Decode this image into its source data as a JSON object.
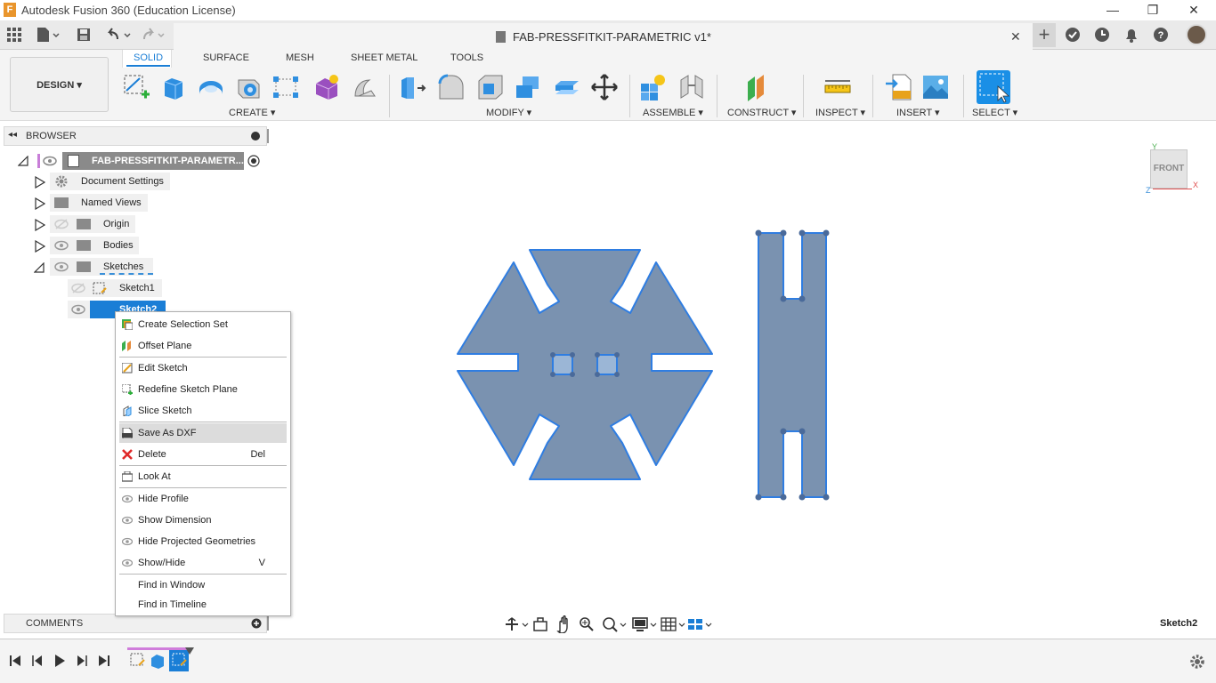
{
  "app": {
    "title": "Autodesk Fusion 360 (Education License)",
    "logo": "F",
    "minimize": "—",
    "restore": "❐",
    "close": "✕"
  },
  "document": {
    "tab_title": "FAB-PRESSFITKIT-PARAMETRIC v1*",
    "close": "✕",
    "new_tab": "+"
  },
  "workspace": {
    "mode": "DESIGN ▾",
    "tabs": [
      "SOLID",
      "SURFACE",
      "MESH",
      "SHEET METAL",
      "TOOLS"
    ],
    "active_tab": "SOLID",
    "groups": [
      "CREATE ▾",
      "MODIFY ▾",
      "ASSEMBLE ▾",
      "CONSTRUCT ▾",
      "INSPECT ▾",
      "INSERT ▾",
      "SELECT ▾"
    ]
  },
  "browser": {
    "title": "BROWSER",
    "collapse": "◂◂",
    "root": "FAB-PRESSFITKIT-PARAMETR...",
    "items": [
      {
        "label": "Document Settings",
        "icon": "gear-icon"
      },
      {
        "label": "Named Views",
        "icon": "folder-icon"
      },
      {
        "label": "Origin",
        "icon": "folder-icon"
      },
      {
        "label": "Bodies",
        "icon": "folder-icon"
      },
      {
        "label": "Sketches",
        "icon": "folder-icon"
      }
    ],
    "sketches": [
      "Sketch1",
      "Sketch2"
    ]
  },
  "context_menu": {
    "items": [
      {
        "label": "Create Selection Set",
        "shortcut": "",
        "icon": "selection-set-icon"
      },
      {
        "label": "Offset Plane",
        "shortcut": "",
        "icon": "offset-plane-icon"
      },
      {
        "label": "Edit Sketch",
        "shortcut": "",
        "icon": "edit-sketch-icon"
      },
      {
        "label": "Redefine Sketch Plane",
        "shortcut": "",
        "icon": "redefine-plane-icon"
      },
      {
        "label": "Slice Sketch",
        "shortcut": "",
        "icon": "slice-icon"
      },
      {
        "label": "Save As DXF",
        "shortcut": "",
        "icon": "dxf-icon"
      },
      {
        "label": "Delete",
        "shortcut": "Del",
        "icon": "delete-icon"
      },
      {
        "label": "Look At",
        "shortcut": "",
        "icon": "look-at-icon"
      },
      {
        "label": "Hide Profile",
        "shortcut": "",
        "icon": "eye-icon"
      },
      {
        "label": "Show Dimension",
        "shortcut": "",
        "icon": "eye-icon"
      },
      {
        "label": "Hide Projected Geometries",
        "shortcut": "",
        "icon": "eye-icon"
      },
      {
        "label": "Show/Hide",
        "shortcut": "V",
        "icon": "eye-icon"
      },
      {
        "label": "Find in Window",
        "shortcut": "",
        "icon": ""
      },
      {
        "label": "Find in Timeline",
        "shortcut": "",
        "icon": ""
      }
    ],
    "highlighted": "Save As DXF"
  },
  "comments": {
    "title": "COMMENTS"
  },
  "viewcube": {
    "face": "FRONT",
    "x_axis": "X",
    "y_axis": "Y",
    "z_axis": "Z"
  },
  "status": {
    "active_sketch": "Sketch2"
  },
  "colors": {
    "accent": "#1a7ed6",
    "sketch_fill": "#7a92b0",
    "sketch_edge": "#2f7de1"
  }
}
